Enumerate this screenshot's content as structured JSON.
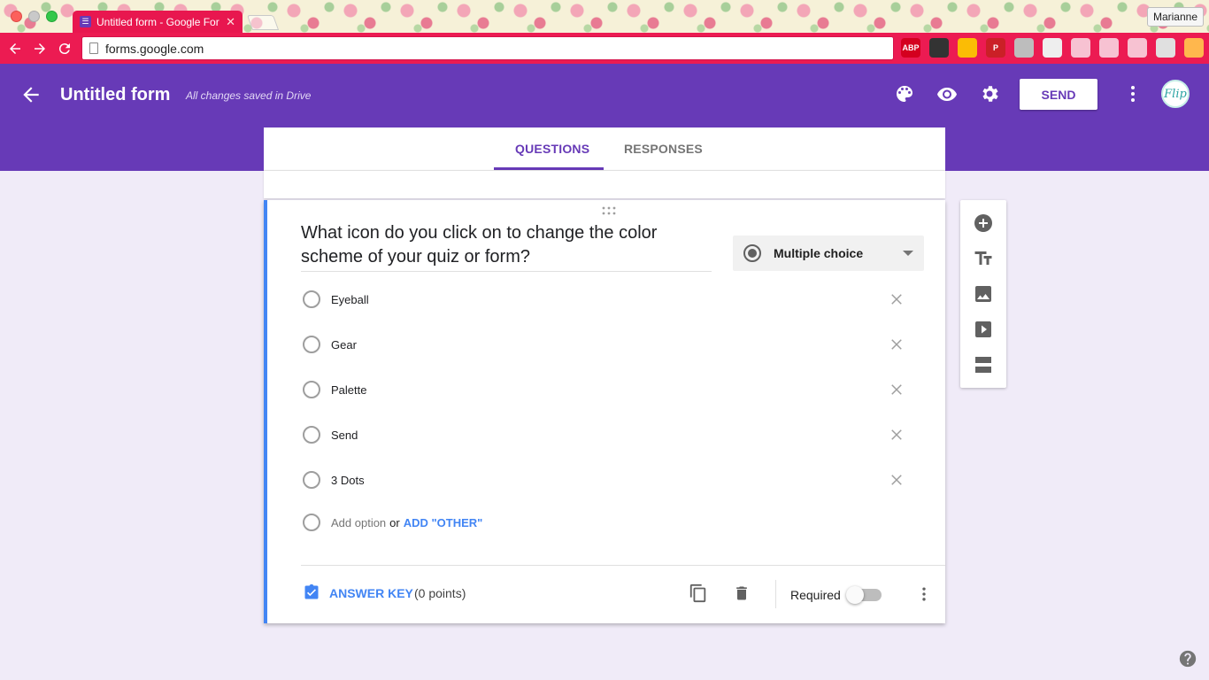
{
  "browser": {
    "tab_title": "Untitled form - Google For",
    "tab_close": "✕",
    "url": "forms.google.com",
    "profile_name": "Marianne",
    "extensions": [
      {
        "name": "adblock-plus-icon",
        "label": "ABP",
        "color": "#d4001f"
      },
      {
        "name": "qr-code-icon",
        "label": "",
        "color": "#333333"
      },
      {
        "name": "chrome-icon",
        "label": "",
        "color": "#fbbc05"
      },
      {
        "name": "pinterest-icon",
        "label": "P",
        "color": "#cb2027"
      },
      {
        "name": "pattern-icon",
        "label": "",
        "color": "#bdbdbd"
      },
      {
        "name": "emoji-icon",
        "label": "",
        "color": "#eeeeee"
      },
      {
        "name": "bookmarks-icon",
        "label": "",
        "color": "#f7c2d2"
      },
      {
        "name": "search-ext-icon",
        "label": "",
        "color": "#f7c2d2"
      },
      {
        "name": "signature-icon",
        "label": "",
        "color": "#f7c2d2"
      },
      {
        "name": "pen-icon",
        "label": "",
        "color": "#e0e0e0"
      },
      {
        "name": "menu-icon",
        "label": "",
        "color": "#ffb74d"
      }
    ]
  },
  "header": {
    "title": "Untitled form",
    "save_status": "All changes saved in Drive",
    "send_label": "SEND",
    "avatar_text": "Flip"
  },
  "tabs": {
    "questions": "QUESTIONS",
    "responses": "RESPONSES"
  },
  "question": {
    "title": "What icon do you click on to change the color scheme of your quiz or form?",
    "type": "Multiple choice",
    "options": [
      "Eyeball",
      "Gear",
      "Palette",
      "Send",
      "3 Dots"
    ],
    "add_option": "Add option",
    "or_text": "or",
    "add_other": "ADD \"OTHER\""
  },
  "footer": {
    "answer_key": "ANSWER KEY",
    "points": "(0 points)",
    "required": "Required"
  },
  "colors": {
    "brand": "#673ab7",
    "accent": "#4285f4",
    "browser_accent": "#ec1b52"
  }
}
